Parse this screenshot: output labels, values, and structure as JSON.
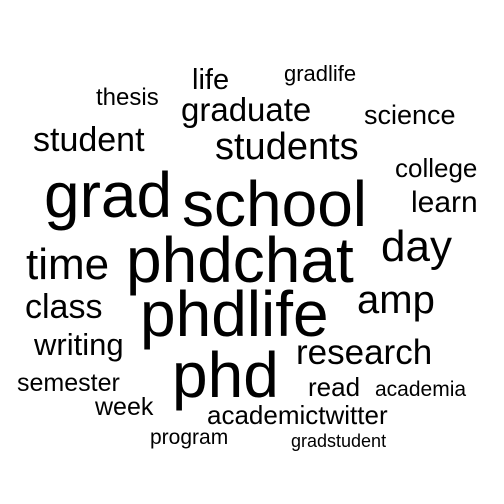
{
  "word_cloud": {
    "text_color": "#000000",
    "background_color": "#ffffff",
    "words": [
      {
        "text": "phdchat"
      },
      {
        "text": "phdlife"
      },
      {
        "text": "gradschool"
      },
      {
        "text": "phd"
      },
      {
        "text": "grad"
      },
      {
        "text": "school"
      },
      {
        "text": "time"
      },
      {
        "text": "day"
      },
      {
        "text": "amp"
      },
      {
        "text": "students"
      },
      {
        "text": "research"
      },
      {
        "text": "graduate"
      },
      {
        "text": "student"
      },
      {
        "text": "class"
      },
      {
        "text": "learn"
      },
      {
        "text": "writing"
      },
      {
        "text": "life"
      },
      {
        "text": "science"
      },
      {
        "text": "college"
      },
      {
        "text": "semester"
      },
      {
        "text": "academictwitter"
      },
      {
        "text": "read"
      },
      {
        "text": "thesis"
      },
      {
        "text": "week"
      },
      {
        "text": "gradlife"
      },
      {
        "text": "academia"
      },
      {
        "text": "program"
      },
      {
        "text": "gradstudent"
      }
    ]
  }
}
